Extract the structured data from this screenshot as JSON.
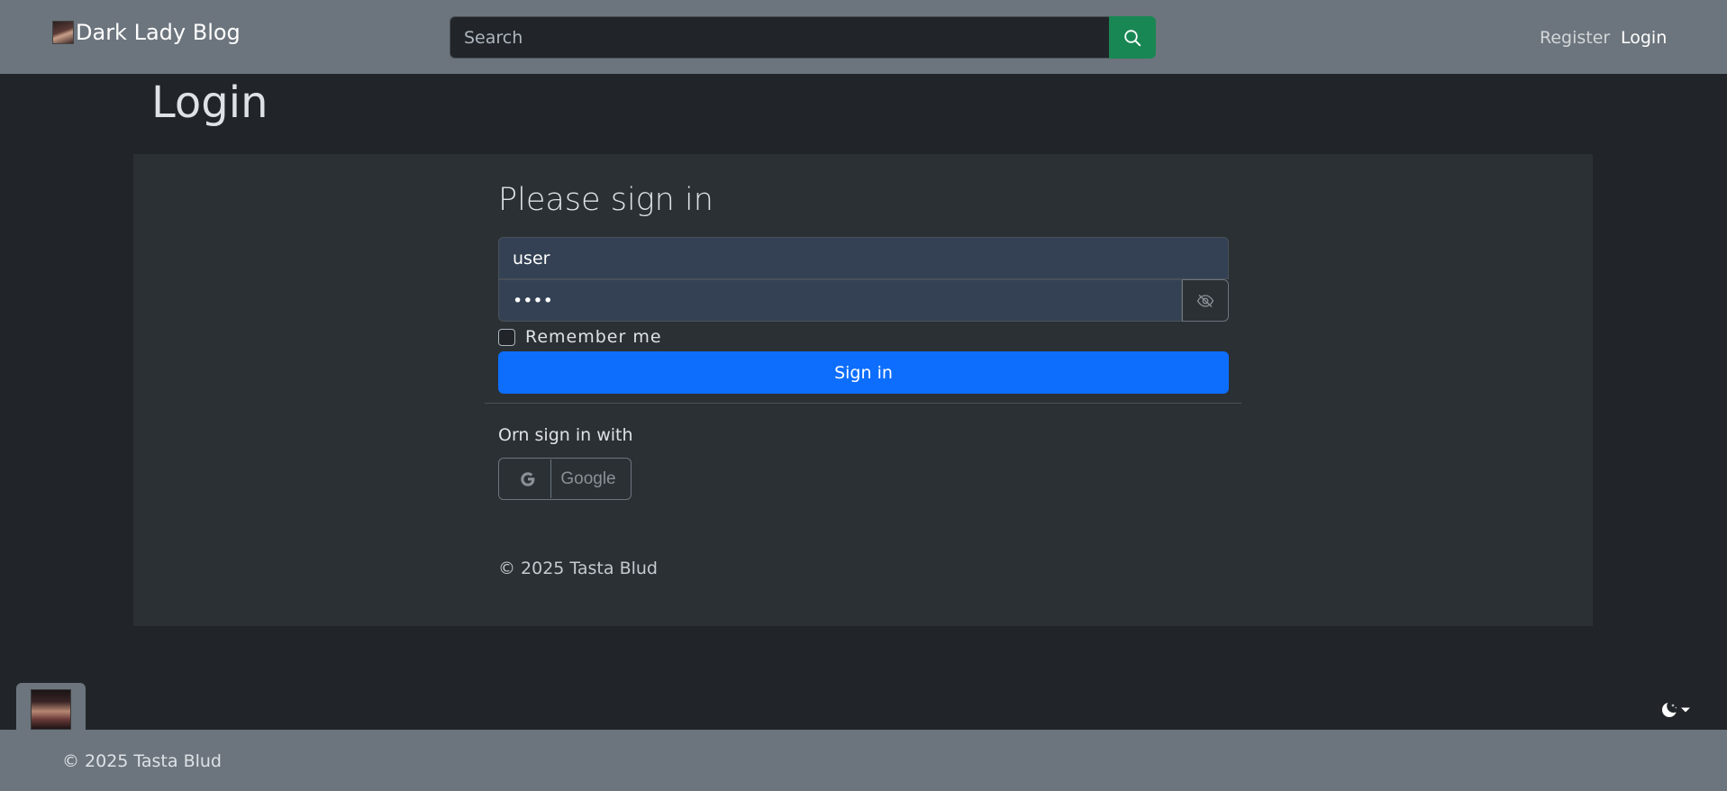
{
  "navbar": {
    "brand": "Dark Lady Blog",
    "search": {
      "placeholder": "Search",
      "value": ""
    },
    "links": {
      "register": "Register",
      "login": "Login"
    }
  },
  "page": {
    "title": "Login"
  },
  "form": {
    "heading": "Please sign in",
    "username": "user",
    "password": "••••",
    "remember_label": "Remember me",
    "remember_checked": false,
    "submit_label": "Sign in",
    "or_text": "Orn sign in with",
    "google_label": "Google"
  },
  "card_footer": "© 2025 Tasta Blud",
  "footer": {
    "copyright": "© 2025 Tasta Blud"
  },
  "icons": {
    "search": "search-icon",
    "password_toggle": "eye-slash-icon",
    "google": "google-icon",
    "theme": "moon-stars-icon",
    "dropdown": "caret-down-icon"
  },
  "colors": {
    "navbar_bg": "#6c757d",
    "page_bg": "#212529",
    "card_bg": "#2b3035",
    "input_bg": "#344154",
    "primary": "#0d6efd",
    "success": "#198754"
  }
}
